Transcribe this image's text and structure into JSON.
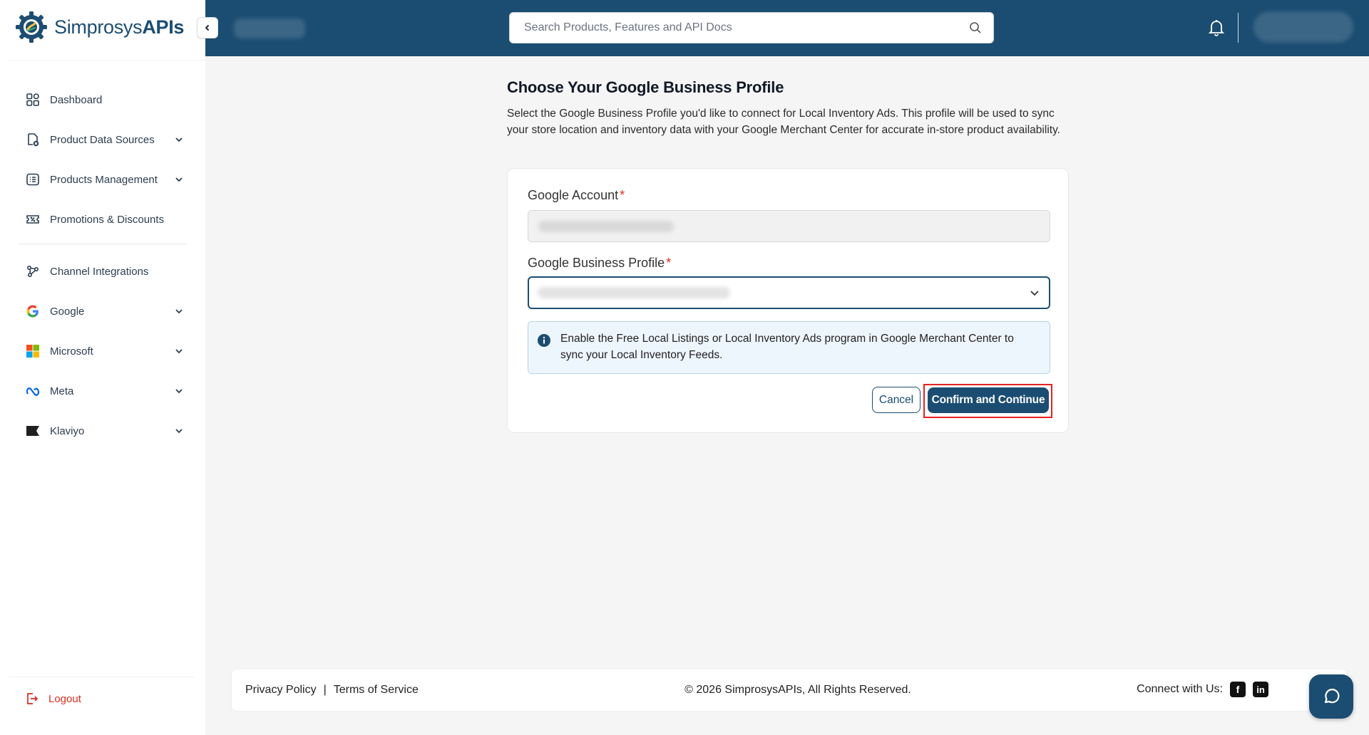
{
  "app": {
    "logo_text_regular": "Simprosys",
    "logo_text_bold": "APIs"
  },
  "sidebar": {
    "items": [
      {
        "label": "Dashboard",
        "icon": "dashboard-icon",
        "expandable": false
      },
      {
        "label": "Product Data Sources",
        "icon": "data-sources-icon",
        "expandable": true
      },
      {
        "label": "Products Management",
        "icon": "list-icon",
        "expandable": true
      },
      {
        "label": "Promotions & Discounts",
        "icon": "coupon-icon",
        "expandable": false
      }
    ],
    "channel_items": [
      {
        "label": "Channel Integrations",
        "icon": "integrations-icon",
        "expandable": false
      },
      {
        "label": "Google",
        "icon": "google-icon",
        "expandable": true
      },
      {
        "label": "Microsoft",
        "icon": "microsoft-icon",
        "expandable": true
      },
      {
        "label": "Meta",
        "icon": "meta-icon",
        "expandable": true
      },
      {
        "label": "Klaviyo",
        "icon": "klaviyo-icon",
        "expandable": true
      }
    ],
    "logout_label": "Logout"
  },
  "header": {
    "search_placeholder": "Search Products, Features and API Docs"
  },
  "main": {
    "title": "Choose Your Google Business Profile",
    "description": "Select the Google Business Profile you'd like to connect for Local Inventory Ads. This profile will be used to sync your store location and inventory data with your Google Merchant Center for accurate in-store product availability.",
    "google_account_label": "Google Account",
    "business_profile_label": "Google Business Profile",
    "required_marker": "*",
    "notice_text": "Enable the Free Local Listings or Local Inventory Ads program in Google Merchant Center to sync your Local Inventory Feeds.",
    "cancel_label": "Cancel",
    "confirm_label": "Confirm and Continue"
  },
  "footer": {
    "privacy_label": "Privacy Policy",
    "separator": "|",
    "terms_label": "Terms of Service",
    "copyright": "© 2026 SimprosysAPIs, All Rights Reserved.",
    "connect_label": "Connect with Us:"
  },
  "colors": {
    "brand_navy": "#1b4d72",
    "required_red": "#d92d20",
    "notice_bg": "#eef6fd"
  }
}
